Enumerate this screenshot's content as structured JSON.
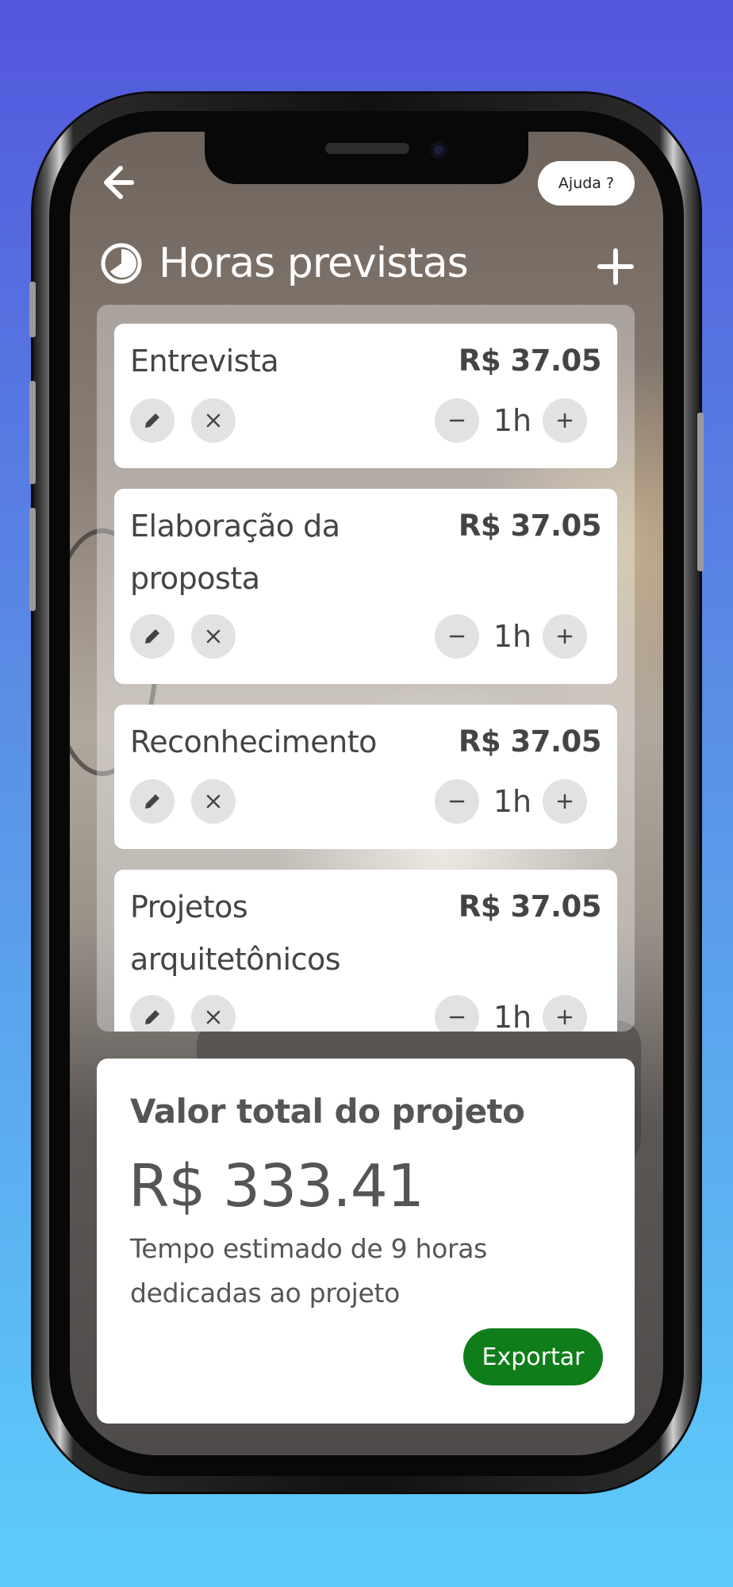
{
  "header": {
    "help_label": "Ajuda ?",
    "title": "Horas previstas"
  },
  "items": [
    {
      "name": "Entrevista",
      "price": "R$ 37.05",
      "hours": "1h"
    },
    {
      "name": "Elaboração da proposta",
      "price": "R$ 37.05",
      "hours": "1h"
    },
    {
      "name": "Reconhecimento",
      "price": "R$ 37.05",
      "hours": "1h"
    },
    {
      "name": "Projetos arquitetônicos",
      "price": "R$ 37.05",
      "hours": "1h"
    }
  ],
  "summary": {
    "label": "Valor total do projeto",
    "total": "R$ 333.41",
    "description": "Tempo estimado de 9 horas dedicadas ao projeto",
    "export_label": "Exportar"
  },
  "colors": {
    "accent_green": "#0f7e1a",
    "gradient_top": "#5257dc",
    "gradient_bottom": "#5ccdfb"
  },
  "icons": {
    "back": "arrow-left-icon",
    "title": "clock-icon",
    "add": "plus-icon",
    "edit": "pencil-icon",
    "delete": "close-icon",
    "decrement": "minus-icon",
    "increment": "plus-icon"
  }
}
